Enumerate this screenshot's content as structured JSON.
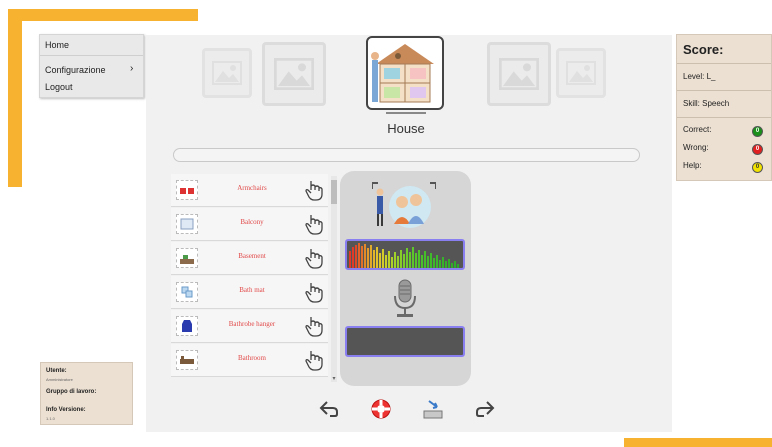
{
  "menu": {
    "home": "Home",
    "configurazione": "Configurazione",
    "submenu_arrow": "›",
    "logout": "Logout"
  },
  "target": {
    "label": "House"
  },
  "words": [
    {
      "label": "Armchairs"
    },
    {
      "label": "Balcony"
    },
    {
      "label": "Basement"
    },
    {
      "label": "Bath mat"
    },
    {
      "label": "Bathrobe hanger"
    },
    {
      "label": "Bathroom"
    }
  ],
  "score": {
    "title": "Score:",
    "level": "Level: L_",
    "skill": "Skill: Speech",
    "correct_label": "Correct:",
    "wrong_label": "Wrong:",
    "help_label": "Help:",
    "correct_value": "0",
    "wrong_value": "0",
    "help_value": "0"
  },
  "user": {
    "utente_label": "Utente:",
    "utente_value": "Amministratore",
    "gruppo_label": "Gruppo di lavoro:",
    "info_label": "Info Versione:",
    "info_value": "1.1.0"
  },
  "colors": {
    "accent": "#f7b230",
    "correct": "#1a8f1a",
    "wrong": "#e02020",
    "help": "#f2e200"
  }
}
